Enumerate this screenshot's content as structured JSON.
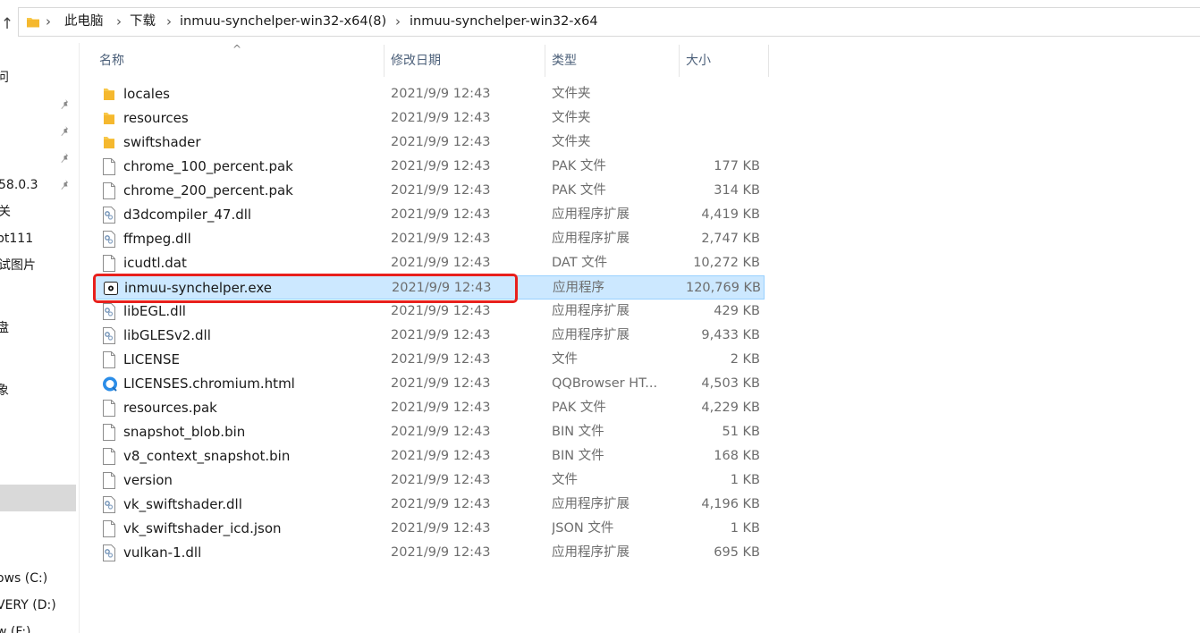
{
  "address_bar": {
    "up_icon": "up-arrow-icon",
    "breadcrumbs": [
      "此电脑",
      "下载",
      "inmuu-synchelper-win32-x64(8)",
      "inmuu-synchelper-win32-x64"
    ],
    "separator": "›"
  },
  "nav_pane": {
    "items": [
      {
        "label": "问",
        "pinned": false
      },
      {
        "label": "",
        "pinned": true
      },
      {
        "label": "",
        "pinned": true
      },
      {
        "label": "",
        "pinned": true
      },
      {
        "label": "58.0.3",
        "pinned": true
      },
      {
        "label": "关",
        "pinned": false
      },
      {
        "label": "pt111",
        "pinned": false
      },
      {
        "label": "试图片",
        "pinned": false
      },
      {
        "label": "盘",
        "pinned": false
      },
      {
        "label": "象",
        "pinned": false
      },
      {
        "label": "ows (C:)",
        "pinned": false
      },
      {
        "label": "VERY (D:)",
        "pinned": false
      },
      {
        "label": "w (F:)",
        "pinned": false
      }
    ]
  },
  "columns": {
    "name": "名称",
    "date": "修改日期",
    "type": "类型",
    "size": "大小"
  },
  "files": [
    {
      "name": "locales",
      "date": "2021/9/9 12:43",
      "type": "文件夹",
      "size": "",
      "icon": "folder-icon"
    },
    {
      "name": "resources",
      "date": "2021/9/9 12:43",
      "type": "文件夹",
      "size": "",
      "icon": "folder-icon"
    },
    {
      "name": "swiftshader",
      "date": "2021/9/9 12:43",
      "type": "文件夹",
      "size": "",
      "icon": "folder-icon"
    },
    {
      "name": "chrome_100_percent.pak",
      "date": "2021/9/9 12:43",
      "type": "PAK 文件",
      "size": "177 KB",
      "icon": "file-icon"
    },
    {
      "name": "chrome_200_percent.pak",
      "date": "2021/9/9 12:43",
      "type": "PAK 文件",
      "size": "314 KB",
      "icon": "file-icon"
    },
    {
      "name": "d3dcompiler_47.dll",
      "date": "2021/9/9 12:43",
      "type": "应用程序扩展",
      "size": "4,419 KB",
      "icon": "dll-icon"
    },
    {
      "name": "ffmpeg.dll",
      "date": "2021/9/9 12:43",
      "type": "应用程序扩展",
      "size": "2,747 KB",
      "icon": "dll-icon"
    },
    {
      "name": "icudtl.dat",
      "date": "2021/9/9 12:43",
      "type": "DAT 文件",
      "size": "10,272 KB",
      "icon": "file-icon"
    },
    {
      "name": "inmuu-synchelper.exe",
      "date": "2021/9/9 12:43",
      "type": "应用程序",
      "size": "120,769 KB",
      "icon": "exe-icon",
      "selected": true
    },
    {
      "name": "libEGL.dll",
      "date": "2021/9/9 12:43",
      "type": "应用程序扩展",
      "size": "429 KB",
      "icon": "dll-icon"
    },
    {
      "name": "libGLESv2.dll",
      "date": "2021/9/9 12:43",
      "type": "应用程序扩展",
      "size": "9,433 KB",
      "icon": "dll-icon"
    },
    {
      "name": "LICENSE",
      "date": "2021/9/9 12:43",
      "type": "文件",
      "size": "2 KB",
      "icon": "file-icon"
    },
    {
      "name": "LICENSES.chromium.html",
      "date": "2021/9/9 12:43",
      "type": "QQBrowser HT...",
      "size": "4,503 KB",
      "icon": "qqbrowser-icon"
    },
    {
      "name": "resources.pak",
      "date": "2021/9/9 12:43",
      "type": "PAK 文件",
      "size": "4,229 KB",
      "icon": "file-icon"
    },
    {
      "name": "snapshot_blob.bin",
      "date": "2021/9/9 12:43",
      "type": "BIN 文件",
      "size": "51 KB",
      "icon": "file-icon"
    },
    {
      "name": "v8_context_snapshot.bin",
      "date": "2021/9/9 12:43",
      "type": "BIN 文件",
      "size": "168 KB",
      "icon": "file-icon"
    },
    {
      "name": "version",
      "date": "2021/9/9 12:43",
      "type": "文件",
      "size": "1 KB",
      "icon": "file-icon"
    },
    {
      "name": "vk_swiftshader.dll",
      "date": "2021/9/9 12:43",
      "type": "应用程序扩展",
      "size": "4,196 KB",
      "icon": "dll-icon"
    },
    {
      "name": "vk_swiftshader_icd.json",
      "date": "2021/9/9 12:43",
      "type": "JSON 文件",
      "size": "1 KB",
      "icon": "file-icon"
    },
    {
      "name": "vulkan-1.dll",
      "date": "2021/9/9 12:43",
      "type": "应用程序扩展",
      "size": "695 KB",
      "icon": "dll-icon"
    }
  ],
  "colors": {
    "selection_bg": "#cce8ff",
    "selection_border": "#99d1ff",
    "annotation_red": "#e8201c",
    "folder_yellow": "#f8c84a",
    "header_text": "#4c607a"
  }
}
